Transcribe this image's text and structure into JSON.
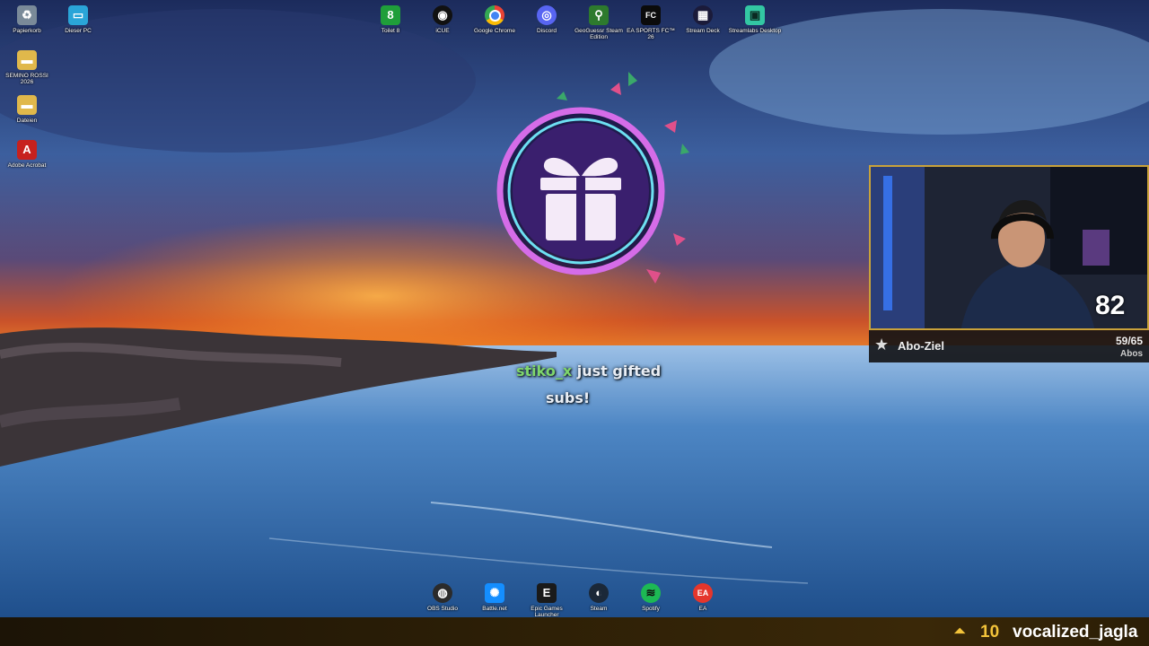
{
  "desktop_icons_left": [
    {
      "label": "Papierkorb",
      "icon": "recycle-bin-icon",
      "color": "#7a8a99"
    },
    {
      "label": "Dieser PC",
      "icon": "monitor-icon",
      "color": "#2aa5d8"
    },
    {
      "label": "SEMINO ROSSI 2026",
      "icon": "folder-icon",
      "color": "#e0b84b"
    },
    {
      "label": "Dateien",
      "icon": "folder-icon",
      "color": "#e0b84b"
    },
    {
      "label": "Adobe Acrobat",
      "icon": "acrobat-icon",
      "color": "#c7211e"
    }
  ],
  "taskbar_top_icons": [
    {
      "label": "Toilet 8",
      "icon": "toilet8-icon",
      "color": "#1f9e3a",
      "glyph": "8"
    },
    {
      "label": "iCUE",
      "icon": "icue-icon",
      "color": "#111111",
      "glyph": "◉"
    },
    {
      "label": "Google Chrome",
      "icon": "chrome-icon",
      "color": "#e8453c",
      "glyph": "●"
    },
    {
      "label": "Discord",
      "icon": "discord-icon",
      "color": "#5865f2",
      "glyph": "◎"
    },
    {
      "label": "GeoGuessr Steam Edition",
      "icon": "geoguessr-icon",
      "color": "#2d7a2d",
      "glyph": "⚲"
    },
    {
      "label": "EA SPORTS FC™ 26",
      "icon": "easportsfc-icon",
      "color": "#0b0b0b",
      "glyph": "FC"
    },
    {
      "label": "Stream Deck",
      "icon": "streamdeck-icon",
      "color": "#1b1b3a",
      "glyph": "▦"
    },
    {
      "label": "Streamlabs Desktop",
      "icon": "streamlabs-icon",
      "color": "#33c7a3",
      "glyph": "▣"
    }
  ],
  "taskbar_bottom_icons": [
    {
      "label": "OBS Studio",
      "icon": "obs-icon",
      "color": "#2b2b2b",
      "glyph": "◍"
    },
    {
      "label": "Battle.net",
      "icon": "battlenet-icon",
      "color": "#148eff",
      "glyph": "✺"
    },
    {
      "label": "Epic Games Launcher",
      "icon": "epic-icon",
      "color": "#1a1a1a",
      "glyph": "E"
    },
    {
      "label": "Steam",
      "icon": "steam-icon",
      "color": "#1b2838",
      "glyph": "◐"
    },
    {
      "label": "Spotify",
      "icon": "spotify-icon",
      "color": "#1db954",
      "glyph": "≋"
    },
    {
      "label": "EA",
      "icon": "ea-icon",
      "color": "#e4362c",
      "glyph": "EA"
    }
  ],
  "gift_alert": {
    "user": "stiko_x",
    "message": "just gifted",
    "line2": "subs!",
    "icon": "gift-icon",
    "ring_color": "#b64bd8"
  },
  "webcam": {
    "counter": "82"
  },
  "sub_goal": {
    "label": "Abo-Ziel",
    "value": "59/65",
    "unit": "Abos",
    "progress": 0.908,
    "icon": "star-icon"
  },
  "ticker": {
    "count": "10",
    "user": "vocalized_jagla",
    "icon": "upvote-icon",
    "accent": "#f3c33a"
  }
}
